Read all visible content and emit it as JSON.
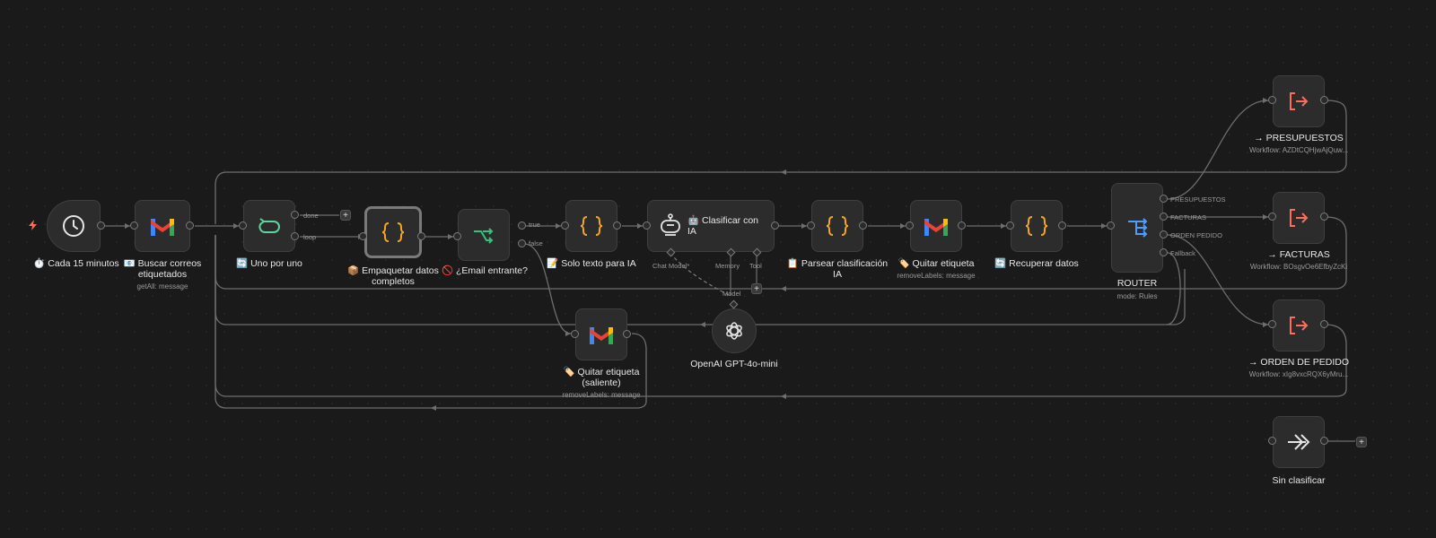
{
  "canvas": {
    "accent_color": "#ff6d5a",
    "background": "#1a1a1a"
  },
  "nodes": {
    "trigger": {
      "label": "⏱️ Cada 15 minutos",
      "icon": "clock-icon"
    },
    "gmail_fetch": {
      "label_line1": "📧 Buscar correos",
      "label_line2": "etiquetados",
      "sub": "getAll: message",
      "icon": "gmail-icon"
    },
    "loop": {
      "label": "🔄 Uno por uno",
      "icon": "loop-icon",
      "out_done": "done",
      "out_loop": "loop"
    },
    "pack": {
      "label_line1": "📦 Empaquetar datos",
      "label_line2": "completos",
      "icon": "braces-icon"
    },
    "if_inbound": {
      "label": "🚫 ¿Email entrante?",
      "icon": "branch-icon",
      "out_true": "true",
      "out_false": "false"
    },
    "text_only": {
      "label": "📝 Solo texto para IA",
      "icon": "braces-icon"
    },
    "classify": {
      "label_line1": "🤖 Clasificar con",
      "label_line2": "IA",
      "icon": "robot-icon",
      "in_chat": "Chat Model*",
      "in_memory": "Memory",
      "in_tool": "Tool"
    },
    "parse": {
      "label_line1": "📋 Parsear clasificación",
      "label_line2": "IA",
      "icon": "braces-icon"
    },
    "remove_label": {
      "label": "🏷️ Quitar etiqueta",
      "sub": "removeLabels: message",
      "icon": "gmail-icon"
    },
    "recover": {
      "label": "🔄 Recuperar datos",
      "icon": "braces-icon"
    },
    "router": {
      "label": "ROUTER",
      "sub": "mode: Rules",
      "icon": "router-icon",
      "outputs": [
        "PRESUPUESTOS",
        "FACTURAS",
        "ORDEN PEDIDO",
        "Fallback"
      ]
    },
    "openai": {
      "label": "OpenAI GPT-4o-mini",
      "icon": "openai-icon",
      "out_model": "Model"
    },
    "remove_label_out": {
      "label_line1": "🏷️ Quitar etiqueta",
      "label_line2": "(saliente)",
      "sub": "removeLabels: message",
      "icon": "gmail-icon"
    },
    "wf_presupuestos": {
      "label": "→ PRESUPUESTOS",
      "sub": "Workflow: AZDtCQHjwAjQuw...",
      "icon": "exit-icon"
    },
    "wf_facturas": {
      "label": "→ FACTURAS",
      "sub": "Workflow: BOsgvOe6EfbyZcKi",
      "icon": "exit-icon"
    },
    "wf_orden": {
      "label": "→ ORDEN DE PEDIDO",
      "sub": "Workflow: xIg8vxcRQX6yMru...",
      "icon": "exit-icon"
    },
    "sin_clasificar": {
      "label": "Sin clasificar",
      "icon": "double-chevron-icon"
    }
  },
  "add_button": "+"
}
